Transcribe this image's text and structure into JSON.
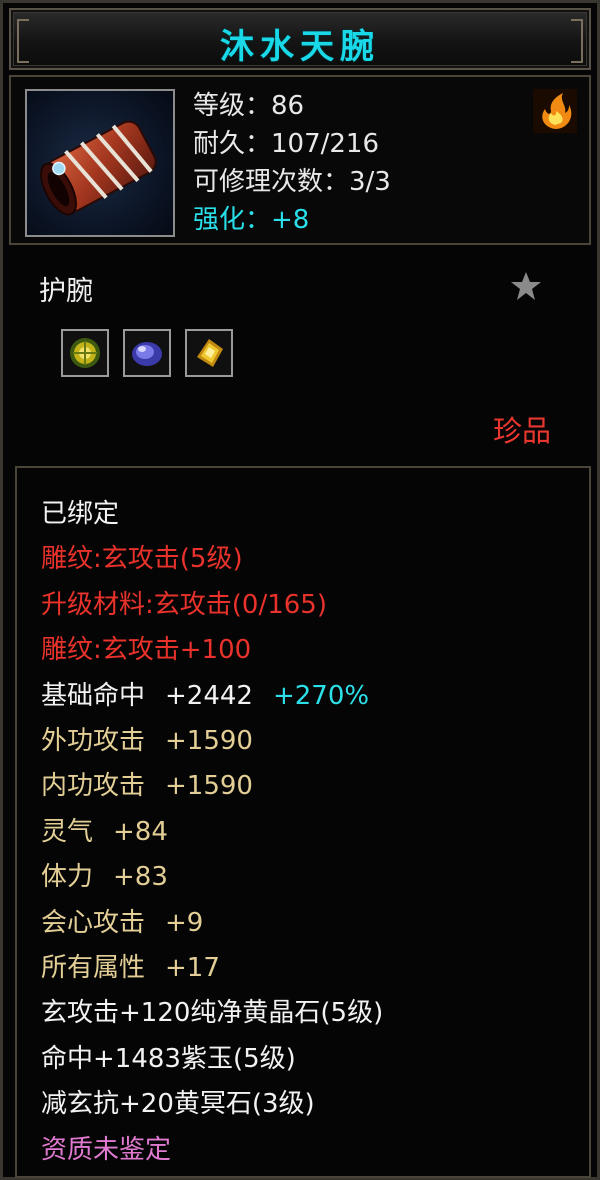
{
  "title": "沐水天腕",
  "header": {
    "level": "等级：86",
    "durability": "耐久：107/216",
    "repairs": "可修理次数：3/3",
    "enhance": "强化：+8"
  },
  "item_type": "护腕",
  "rarity": "珍品",
  "icons": {
    "item": "bracer-icon",
    "flame": "flame-icon",
    "star": "star-icon",
    "gems": [
      "yellow-green-gem-icon",
      "purple-gem-icon",
      "yellow-gem-icon"
    ]
  },
  "stats": {
    "bound": "已绑定",
    "engrave1": "雕纹:玄攻击(5级)",
    "upgrade": "升级材料:玄攻击(0/165)",
    "engrave2": "雕纹:玄攻击+100",
    "hit_name": "基础命中",
    "hit_value": "+2442",
    "hit_pct": "+270%",
    "ext_attack_name": "外功攻击",
    "ext_attack_value": "+1590",
    "int_attack_name": "内功攻击",
    "int_attack_value": "+1590",
    "spirit_name": "灵气",
    "spirit_value": "+84",
    "stamina_name": "体力",
    "stamina_value": "+83",
    "crit_name": "会心攻击",
    "crit_value": "+9",
    "all_name": "所有属性",
    "all_value": "+17",
    "gem1": "玄攻击+120纯净黄晶石(5级)",
    "gem2": "命中+1483紫玉(5级)",
    "gem3": "减玄抗+20黄冥石(3级)",
    "quality": "资质未鉴定"
  },
  "colors": {
    "title": "#19d8e8",
    "enhance": "#29e0ea",
    "red": "#e8322b",
    "gold": "#e3cf96",
    "pink": "#e07ad0",
    "rarity": "#e8372f"
  }
}
